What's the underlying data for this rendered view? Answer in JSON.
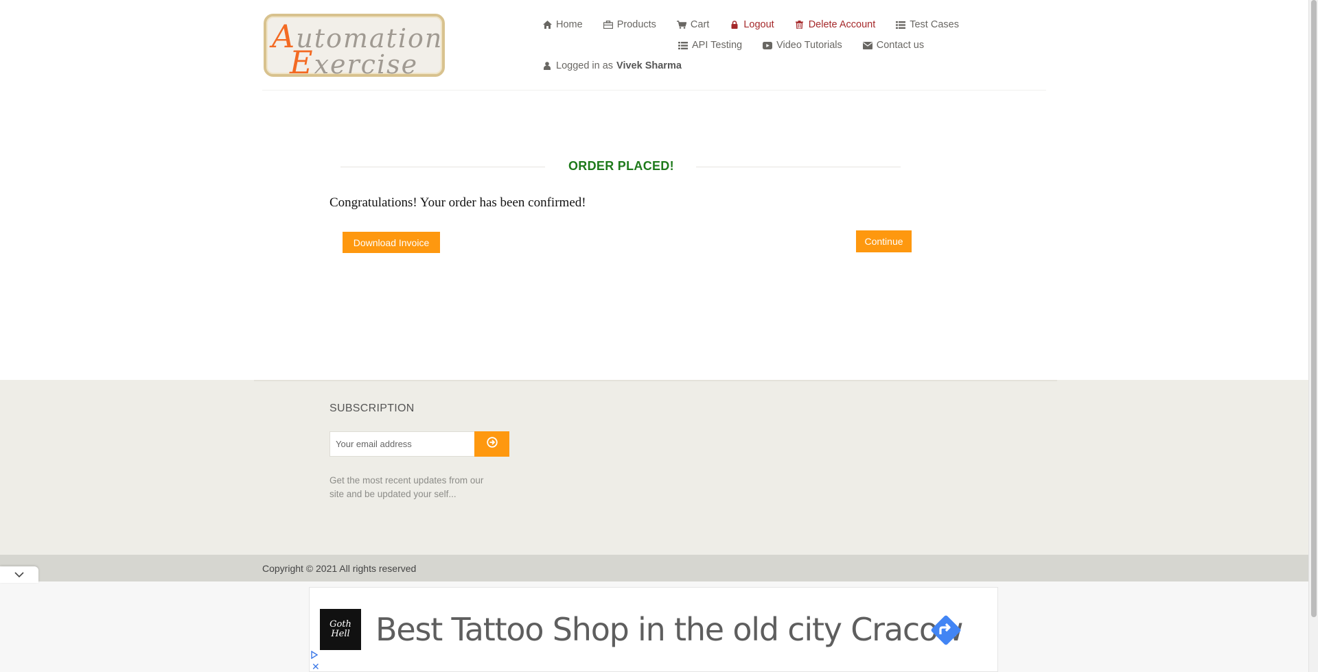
{
  "logo": {
    "line1_cap": "A",
    "line1_rest": "utomation",
    "line2_cap": "E",
    "line2_rest": "xercise"
  },
  "nav": {
    "items": [
      {
        "label": "Home",
        "icon": "home-icon"
      },
      {
        "label": "Products",
        "icon": "briefcase-icon"
      },
      {
        "label": "Cart",
        "icon": "cart-icon"
      },
      {
        "label": "Logout",
        "icon": "lock-icon"
      },
      {
        "label": "Delete Account",
        "icon": "trash-icon"
      },
      {
        "label": "Test Cases",
        "icon": "list-icon"
      },
      {
        "label": "API Testing",
        "icon": "list-icon"
      },
      {
        "label": "Video Tutorials",
        "icon": "youtube-icon"
      },
      {
        "label": "Contact us",
        "icon": "envelope-icon"
      }
    ],
    "logged_in_prefix": "Logged in as",
    "logged_in_user": "Vivek Sharma"
  },
  "order": {
    "title": "ORDER PLACED!",
    "message": "Congratulations! Your order has been confirmed!",
    "download_label": "Download Invoice",
    "continue_label": "Continue"
  },
  "subscription": {
    "title": "SUBSCRIPTION",
    "placeholder": "Your email address",
    "description": "Get the most recent updates from our site and be updated your self..."
  },
  "footer": {
    "copyright": "Copyright © 2021 All rights reserved"
  },
  "ad": {
    "headline": "Best Tattoo Shop in the old city Cracow",
    "logo_text": "Goth Hell"
  },
  "colors": {
    "accent": "#fe980f",
    "success": "#1e7a1b",
    "danger": "#a5282a",
    "footer_bg": "#eeede7"
  }
}
